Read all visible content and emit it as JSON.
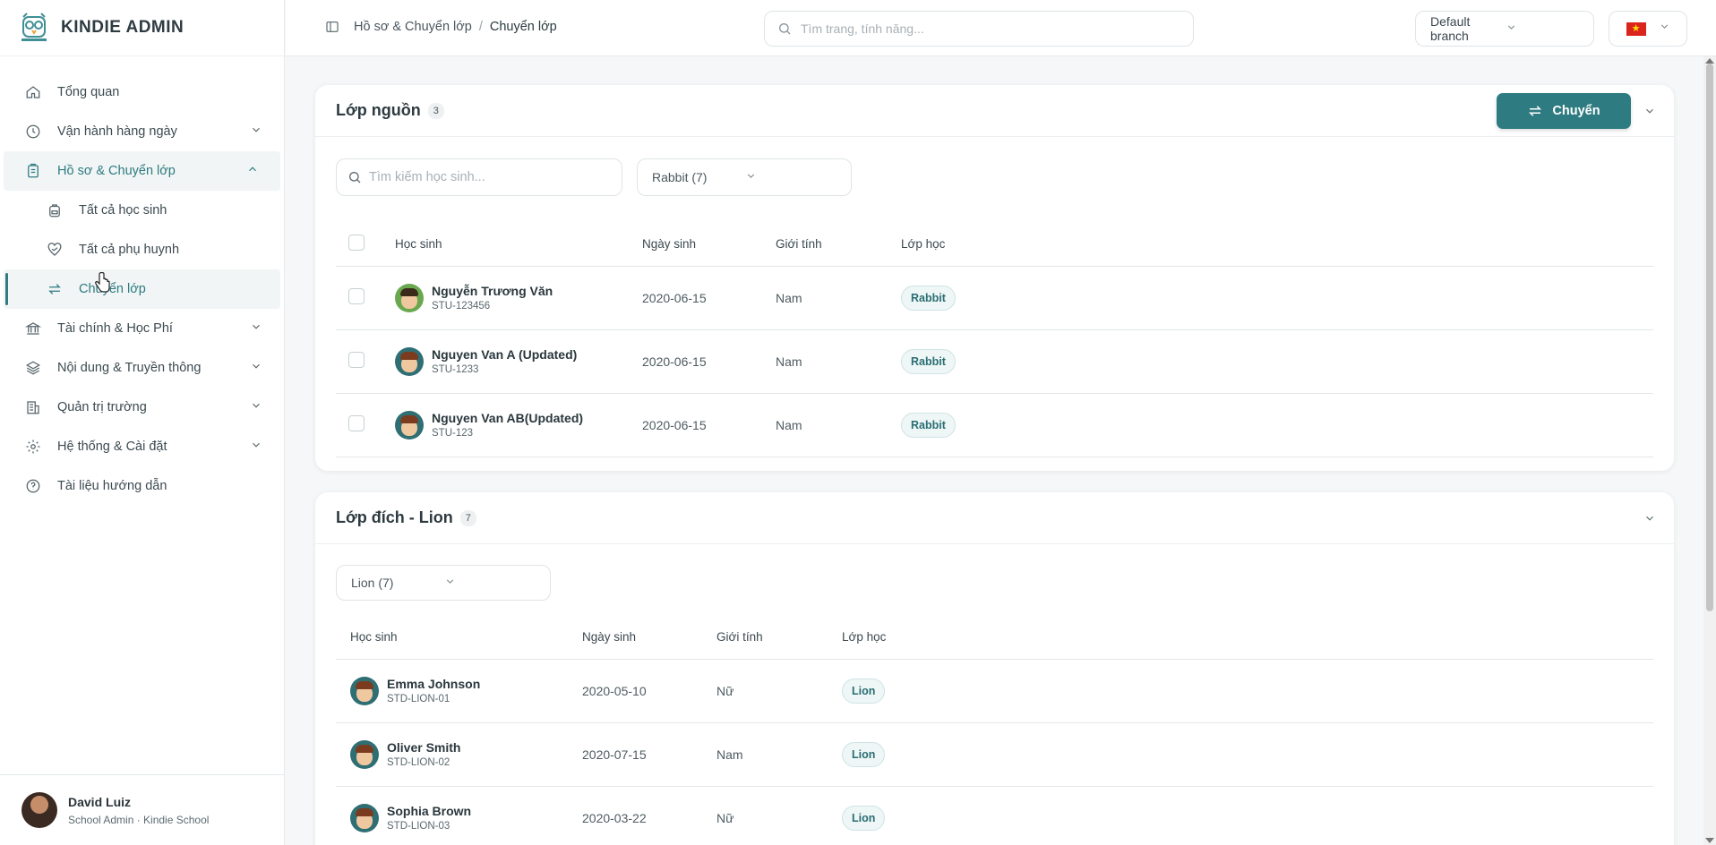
{
  "brand": {
    "name": "KINDIE ADMIN"
  },
  "sidebar": {
    "items": [
      {
        "label": "Tổng quan",
        "icon": "home-icon"
      },
      {
        "label": "Vận hành hàng ngày",
        "icon": "clock-icon"
      },
      {
        "label": "Hồ sơ & Chuyển lớp",
        "icon": "clipboard-icon"
      },
      {
        "label": "Tài chính & Học Phí",
        "icon": "bank-icon"
      },
      {
        "label": "Nội dung & Truyền thông",
        "icon": "layers-icon"
      },
      {
        "label": "Quản trị trường",
        "icon": "building-icon"
      },
      {
        "label": "Hệ thống & Cài đặt",
        "icon": "gear-icon"
      },
      {
        "label": "Tài liệu hướng dẫn",
        "icon": "help-icon"
      }
    ],
    "sub_items": [
      {
        "label": "Tất cả học sinh",
        "icon": "backpack-icon"
      },
      {
        "label": "Tất cả phụ huynh",
        "icon": "heart-hand-icon"
      },
      {
        "label": "Chuyển lớp",
        "icon": "transfer-icon"
      }
    ]
  },
  "user": {
    "name": "David Luiz",
    "role": "School Admin · Kindie School"
  },
  "header": {
    "breadcrumb": [
      "Hồ sơ & Chuyển lớp",
      "/",
      "Chuyển lớp"
    ],
    "search_placeholder": "Tìm trang, tính năng...",
    "branch": "Default branch",
    "flag_star": "★"
  },
  "source": {
    "title": "Lớp nguồn",
    "count": "3",
    "move_button": "Chuyển",
    "search_placeholder": "Tìm kiếm học sinh...",
    "class_select": "Rabbit (7)",
    "columns": [
      "Học sinh",
      "Ngày sinh",
      "Giới tính",
      "Lớp học"
    ],
    "rows": [
      {
        "name": "Nguyễn Trương Văn",
        "code": "STU-123456",
        "dob": "2020-06-15",
        "gender": "Nam",
        "class": "Rabbit"
      },
      {
        "name": "Nguyen Van A (Updated)",
        "code": "STU-1233",
        "dob": "2020-06-15",
        "gender": "Nam",
        "class": "Rabbit"
      },
      {
        "name": "Nguyen Van AB(Updated)",
        "code": "STU-123",
        "dob": "2020-06-15",
        "gender": "Nam",
        "class": "Rabbit"
      }
    ]
  },
  "target": {
    "title": "Lớp đích - Lion",
    "count": "7",
    "class_select": "Lion (7)",
    "columns": [
      "Học sinh",
      "Ngày sinh",
      "Giới tính",
      "Lớp học"
    ],
    "rows": [
      {
        "name": "Emma Johnson",
        "code": "STD-LION-01",
        "dob": "2020-05-10",
        "gender": "Nữ",
        "class": "Lion"
      },
      {
        "name": "Oliver Smith",
        "code": "STD-LION-02",
        "dob": "2020-07-15",
        "gender": "Nam",
        "class": "Lion"
      },
      {
        "name": "Sophia Brown",
        "code": "STD-LION-03",
        "dob": "2020-03-22",
        "gender": "Nữ",
        "class": "Lion"
      }
    ]
  },
  "colors": {
    "accent": "#2e7b81",
    "tag_bg": "#eef6f6"
  }
}
